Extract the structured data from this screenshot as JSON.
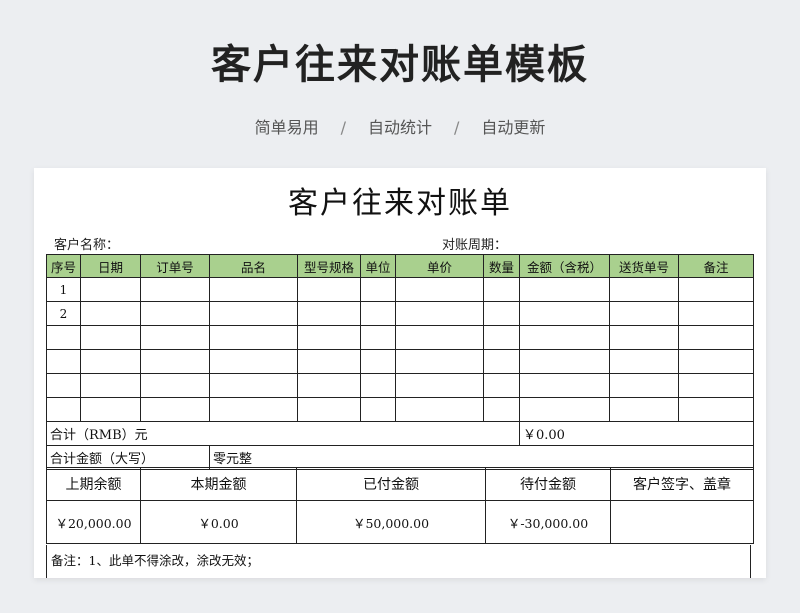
{
  "banner": {
    "title": "客户往来对账单模板",
    "tags": [
      "简单易用",
      "自动统计",
      "自动更新"
    ],
    "separator": "/"
  },
  "document": {
    "title": "客户往来对账单",
    "customer_label": "客户名称：",
    "period_label": "对账周期：",
    "header_color": "#a9d08e",
    "columns": [
      "序号",
      "日期",
      "订单号",
      "品名",
      "型号规格",
      "单位",
      "单价",
      "数量",
      "金额（含税）",
      "送货单号",
      "备注"
    ],
    "row_indices": [
      "1",
      "2",
      "",
      "",
      "",
      ""
    ],
    "total_label": "合计（RMB）元",
    "total_value": "￥0.00",
    "words_label": "合计金额（大写）",
    "words_value": "零元整",
    "summary_headers": [
      "上期余额",
      "本期金额",
      "已付金额",
      "待付金额",
      "客户签字、盖章"
    ],
    "summary_values": [
      "￥20,000.00",
      "￥0.00",
      "￥50,000.00",
      "￥-30,000.00",
      ""
    ],
    "note": "备注：1、此单不得涂改，涂改无效；"
  }
}
